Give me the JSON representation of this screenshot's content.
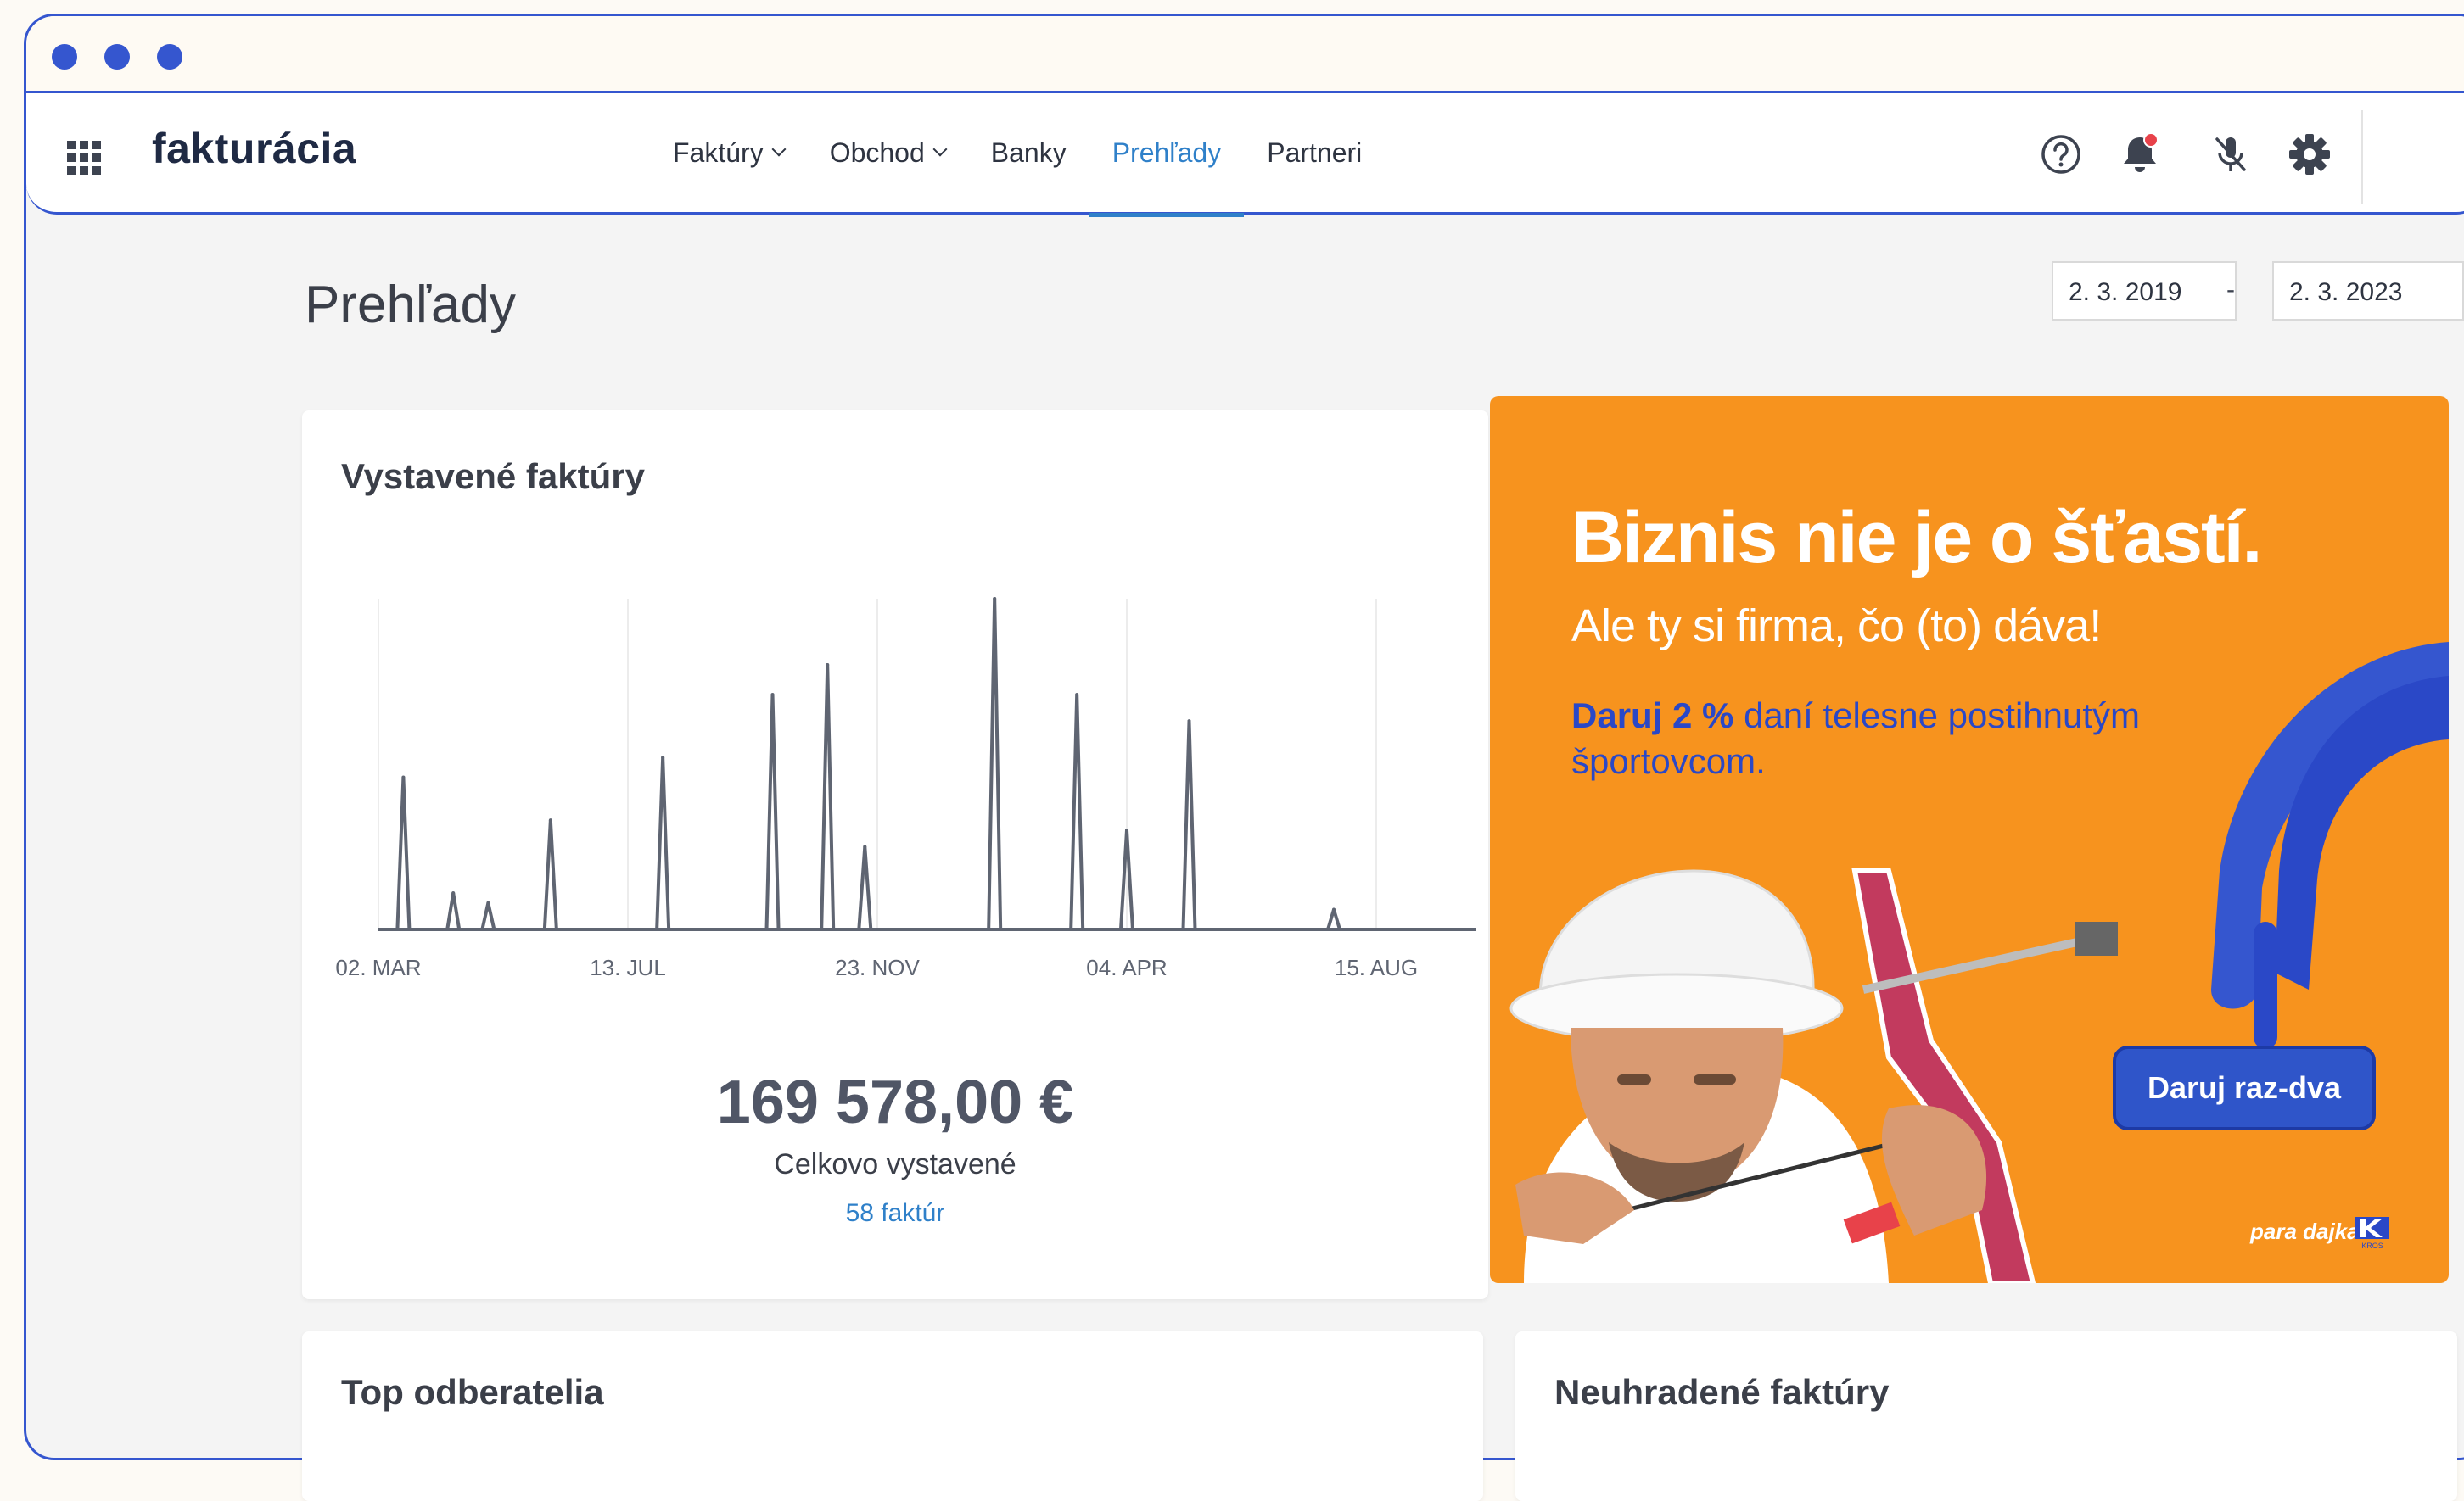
{
  "app": {
    "logo": "fakturácia"
  },
  "nav": {
    "items": [
      {
        "label": "Faktúry",
        "dropdown": true
      },
      {
        "label": "Obchod",
        "dropdown": true
      },
      {
        "label": "Banky",
        "dropdown": false
      },
      {
        "label": "Prehľady",
        "dropdown": false,
        "active": true
      },
      {
        "label": "Partneri",
        "dropdown": false
      }
    ],
    "icons": [
      "help-icon",
      "bell-icon",
      "mic-off-icon",
      "gear-icon"
    ]
  },
  "page": {
    "title": "Prehľady",
    "date_from": "2. 3. 2019",
    "date_sep": "-",
    "date_to": "2. 3. 2023"
  },
  "invoices_card": {
    "title": "Vystavené faktúry",
    "amount": "169 578,00 €",
    "amount_label": "Celkovo vystavené",
    "count_link": "58 faktúr"
  },
  "chart_data": {
    "type": "line",
    "title": "",
    "xlabel": "",
    "ylabel": "",
    "x_ticks": [
      "02. MAR",
      "13. JUL",
      "23. NOV",
      "04. APR",
      "15. AUG"
    ],
    "grid": true,
    "spikes": [
      {
        "x": 0.1,
        "y": 0.46
      },
      {
        "x": 0.3,
        "y": 0.11
      },
      {
        "x": 0.44,
        "y": 0.08
      },
      {
        "x": 0.69,
        "y": 0.33
      },
      {
        "x": 1.14,
        "y": 0.52
      },
      {
        "x": 1.58,
        "y": 0.71
      },
      {
        "x": 1.8,
        "y": 0.8
      },
      {
        "x": 1.95,
        "y": 0.25
      },
      {
        "x": 2.47,
        "y": 1.0
      },
      {
        "x": 2.8,
        "y": 0.71
      },
      {
        "x": 3.0,
        "y": 0.3
      },
      {
        "x": 3.25,
        "y": 0.63
      },
      {
        "x": 3.83,
        "y": 0.06
      }
    ]
  },
  "banner": {
    "headline": "Biznis nie je o šťastí.",
    "subheadline": "Ale ty si firma, čo (to) dáva!",
    "text_bold": "Daruj 2 %",
    "text_rest": " daní telesne postihnutým športovcom.",
    "button": "Daruj raz-dva",
    "logo1": "para dajka.",
    "logo2": "KROS",
    "bg_color": "#f7931e",
    "accent": "#2f55c9"
  },
  "cards_bottom": {
    "left_title": "Top odberatelia",
    "right_title": "Neuhradené faktúry"
  },
  "colors": {
    "brand": "#3556cf",
    "link": "#2f80c9",
    "text": "#3d4350"
  }
}
